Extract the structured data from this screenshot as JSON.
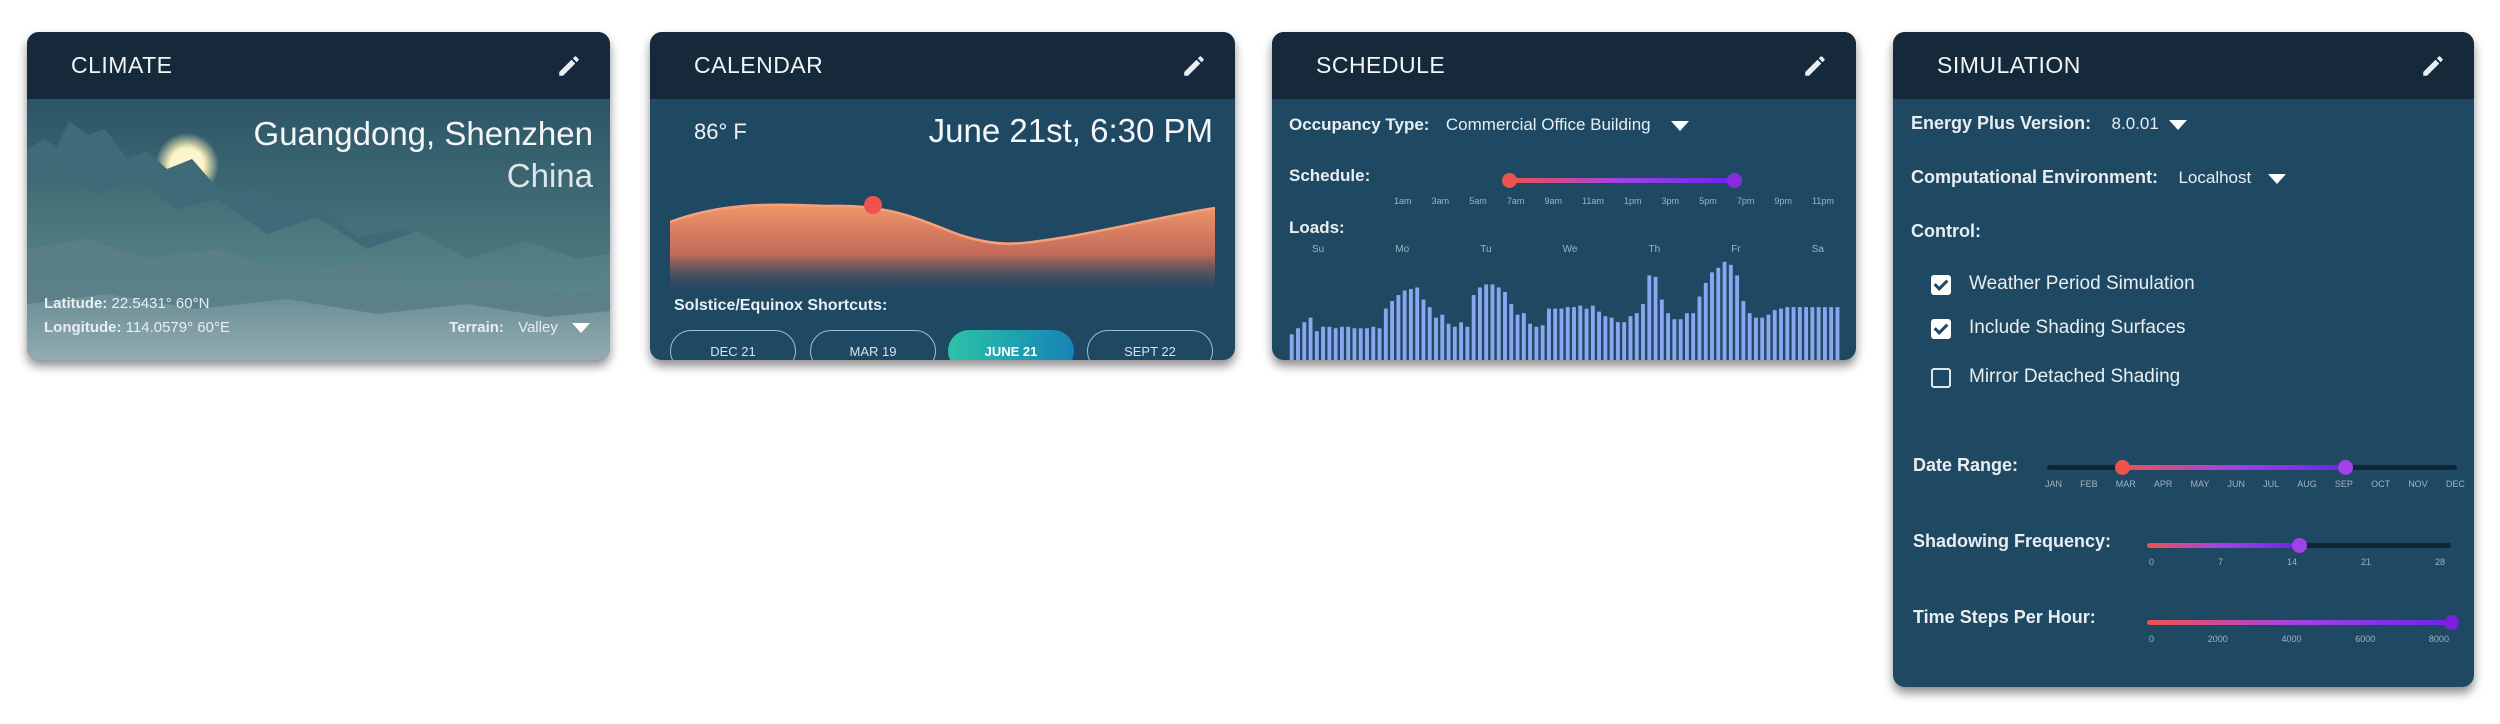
{
  "climate": {
    "title": "CLIMATE",
    "city": "Guangdong, Shenzhen",
    "country": "China",
    "latitude_label": "Latitude:",
    "latitude_value": "22.5431° 60°N",
    "longitude_label": "Longitude:",
    "longitude_value": "114.0579° 60°E",
    "terrain_label": "Terrain:",
    "terrain_value": "Valley"
  },
  "calendar": {
    "title": "CALENDAR",
    "temperature": "86° F",
    "date": "June 21st, 6:30 PM",
    "shortcuts_label": "Solstice/Equinox Shortcuts:",
    "shortcuts": [
      "DEC 21",
      "MAR 19",
      "JUNE 21",
      "SEPT 22"
    ],
    "active_shortcut": "JUNE 21"
  },
  "schedule": {
    "title": "SCHEDULE",
    "occupancy_label": "Occupancy Type:",
    "occupancy_value": "Commercial Office Building",
    "schedule_label": "Schedule:",
    "hour_ticks": [
      "1am",
      "3am",
      "5am",
      "7am",
      "9am",
      "11am",
      "1pm",
      "3pm",
      "5pm",
      "7pm",
      "9pm",
      "11pm"
    ],
    "schedule_range_fraction": [
      0.27,
      0.77
    ],
    "loads_label": "Loads:",
    "days": [
      "Su",
      "Mo",
      "Tu",
      "We",
      "Th",
      "Fr",
      "Sa"
    ],
    "load_bars": [
      0.34,
      0.42,
      0.5,
      0.56,
      0.38,
      0.44,
      0.44,
      0.42,
      0.44,
      0.44,
      0.42,
      0.42,
      0.42,
      0.44,
      0.42,
      0.68,
      0.78,
      0.86,
      0.92,
      0.94,
      0.96,
      0.8,
      0.7,
      0.56,
      0.6,
      0.48,
      0.44,
      0.5,
      0.44,
      0.86,
      0.96,
      1.0,
      1.0,
      0.96,
      0.9,
      0.74,
      0.6,
      0.62,
      0.48,
      0.44,
      0.46,
      0.68,
      0.68,
      0.68,
      0.7,
      0.7,
      0.72,
      0.68,
      0.72,
      0.64,
      0.58,
      0.56,
      0.5,
      0.5,
      0.58,
      0.62,
      0.74,
      1.12,
      1.1,
      0.8,
      0.62,
      0.54,
      0.54,
      0.62,
      0.62,
      0.84,
      1.02,
      1.16,
      1.22,
      1.3,
      1.26,
      1.12,
      0.78,
      0.62,
      0.56,
      0.56,
      0.6,
      0.66,
      0.68,
      0.7,
      0.7,
      0.7,
      0.7,
      0.7,
      0.7,
      0.7,
      0.7,
      0.7
    ]
  },
  "simulation": {
    "title": "SIMULATION",
    "eplus_label": "Energy Plus Version:",
    "eplus_value": "8.0.01",
    "env_label": "Computational Environment:",
    "env_value": "Localhost",
    "control_label": "Control:",
    "controls": [
      {
        "label": "Weather Period Simulation",
        "checked": true
      },
      {
        "label": "Include Shading Surfaces",
        "checked": true
      },
      {
        "label": "Mirror Detached Shading",
        "checked": false
      }
    ],
    "date_range_label": "Date Range:",
    "months": [
      "JAN",
      "FEB",
      "MAR",
      "APR",
      "MAY",
      "JUN",
      "JUL",
      "AUG",
      "SEP",
      "OCT",
      "NOV",
      "DEC"
    ],
    "date_range_start": "MAR",
    "date_range_end": "SEP",
    "shadowing_label": "Shadowing Frequency:",
    "shadowing_ticks": [
      "0",
      "7",
      "14",
      "21",
      "28"
    ],
    "shadowing_value": 14,
    "timesteps_label": "Time Steps Per Hour:",
    "timesteps_ticks": [
      "0",
      "2000",
      "4000",
      "6000",
      "8000"
    ],
    "timesteps_value": 8000
  },
  "colors": {
    "card_body": "#1f4862",
    "card_header": "#15293a",
    "accent_red": "#f0524f",
    "accent_purple": "#8a2be2",
    "accent_teal": "#2cc3a6",
    "load_bar": "#8aa6f0"
  },
  "icons": {
    "edit": "pencil-icon",
    "dropdown": "caret-down-icon",
    "check": "checkbox-icon"
  }
}
